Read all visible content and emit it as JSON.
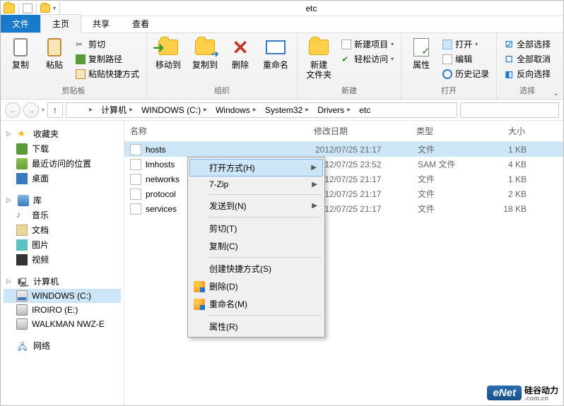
{
  "window": {
    "title": "etc"
  },
  "tabs": {
    "file": "文件",
    "home": "主页",
    "share": "共享",
    "view": "查看"
  },
  "ribbon": {
    "clipboard": {
      "label": "剪贴板",
      "copy": "复制",
      "paste": "粘贴",
      "cut": "剪切",
      "copy_path": "复制路径",
      "paste_shortcut": "粘贴快捷方式"
    },
    "organize": {
      "label": "组织",
      "move_to": "移动到",
      "copy_to": "复制到",
      "delete": "删除",
      "rename": "重命名"
    },
    "new": {
      "label": "新建",
      "new_folder_line1": "新建",
      "new_folder_line2": "文件夹",
      "new_item": "新建项目",
      "easy_access": "轻松访问"
    },
    "open": {
      "label": "打开",
      "properties": "属性",
      "open": "打开",
      "edit": "编辑",
      "history": "历史记录"
    },
    "select": {
      "label": "选择",
      "select_all": "全部选择",
      "select_none": "全部取消",
      "invert": "反向选择"
    }
  },
  "breadcrumbs": [
    "计算机",
    "WINDOWS (C:)",
    "Windows",
    "System32",
    "Drivers",
    "etc"
  ],
  "columns": {
    "name": "名称",
    "date": "修改日期",
    "type": "类型",
    "size": "大小"
  },
  "files": [
    {
      "name": "hosts",
      "date": "2012/07/25 21:17",
      "type": "文件",
      "size": "1 KB",
      "selected": true
    },
    {
      "name": "lmhosts",
      "date": "2012/07/25 23:52",
      "type": "SAM 文件",
      "size": "4 KB"
    },
    {
      "name": "networks",
      "date": "2012/07/25 21:17",
      "type": "文件",
      "size": "1 KB"
    },
    {
      "name": "protocol",
      "date": "2012/07/25 21:17",
      "type": "文件",
      "size": "2 KB"
    },
    {
      "name": "services",
      "date": "2012/07/25 21:17",
      "type": "文件",
      "size": "18 KB"
    }
  ],
  "nav": {
    "favorites": {
      "head": "收藏夹",
      "items": [
        "下载",
        "最近访问的位置",
        "桌面"
      ]
    },
    "libraries": {
      "head": "库",
      "items": [
        "音乐",
        "文档",
        "图片",
        "视频"
      ]
    },
    "computer": {
      "head": "计算机",
      "items": [
        "WINDOWS (C:)",
        "IROIRO (E:)",
        "WALKMAN NWZ-E"
      ]
    },
    "network": {
      "head": "网络"
    }
  },
  "context_menu": {
    "open_with": "打开方式(H)",
    "seven_zip": "7-Zip",
    "send_to": "发送到(N)",
    "cut": "剪切(T)",
    "copy": "复制(C)",
    "create_shortcut": "创建快捷方式(S)",
    "delete": "删除(D)",
    "rename": "重命名(M)",
    "properties": "属性(R)"
  },
  "watermark": {
    "badge": "eNet",
    "text": "硅谷动力",
    "sub": ".com.cn"
  }
}
